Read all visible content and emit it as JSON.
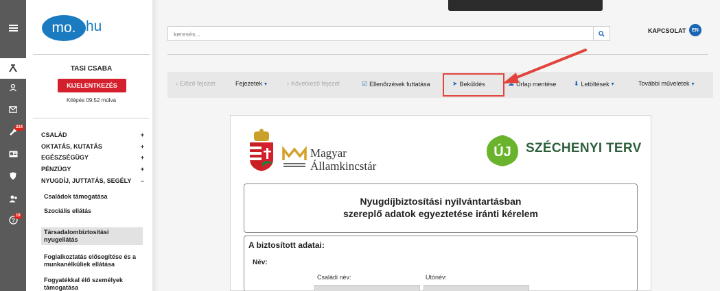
{
  "search": {
    "placeholder": "keresés..."
  },
  "header": {
    "contact_label": "KAPCSOLAT",
    "language": "EN"
  },
  "rail": {
    "badge_tools": "224",
    "badge_help": "18"
  },
  "logo": {
    "left": "mo.",
    "right": "hu"
  },
  "user": {
    "name": "TASI CSABA",
    "logout_label": "KIJELENTKEZÉS",
    "timer_text": "Kilépés 09:52 múlva"
  },
  "sidebar": {
    "categories": [
      {
        "label": "CSALÁD",
        "toggle": "+"
      },
      {
        "label": "OKTATÁS, KUTATÁS",
        "toggle": "+"
      },
      {
        "label": "EGÉSZSÉGÜGY",
        "toggle": "+"
      },
      {
        "label": "PÉNZÜGY",
        "toggle": "+"
      },
      {
        "label": "NYUGDÍJ, JUTTATÁS, SEGÉLY",
        "toggle": "–"
      }
    ],
    "subitems": [
      "Családok támogatása",
      "Szociális ellátás",
      "Társadalombiztosítási nyugellátás",
      "Foglalkoztatás elősegítése és a munkanélküliek ellátása",
      "Fogyatékkal élő személyek támogatása"
    ]
  },
  "toolbar": {
    "prev_chapter": "Előző fejezet",
    "chapters": "Fejezetek",
    "next_chapter": "Következő fejezet",
    "run_checks": "Ellenőrzések futtatása",
    "submit": "Beküldés",
    "save_form": "Űrlap mentése",
    "downloads": "Letöltések",
    "more_actions": "További műveletek"
  },
  "form": {
    "mak_line1": "Magyar",
    "mak_line2": "Államkincstár",
    "uj_label": "ÚJ",
    "szechenyi_label": "SZÉCHENYI TERV",
    "title_line1": "Nyugdíjbiztosítási nyilvántartásban",
    "title_line2": "szereplő adatok egyeztetése iránti kérelem",
    "section_heading": "A biztosított adatai:",
    "name_label": "Név:",
    "family_name_label": "Családi név:",
    "given_name_label": "Utónév:"
  },
  "colors": {
    "brand_blue": "#1a7bc0",
    "logout_red": "#d4202c",
    "highlight_red": "#e2443c",
    "szechenyi_green": "#2d5f3b"
  }
}
